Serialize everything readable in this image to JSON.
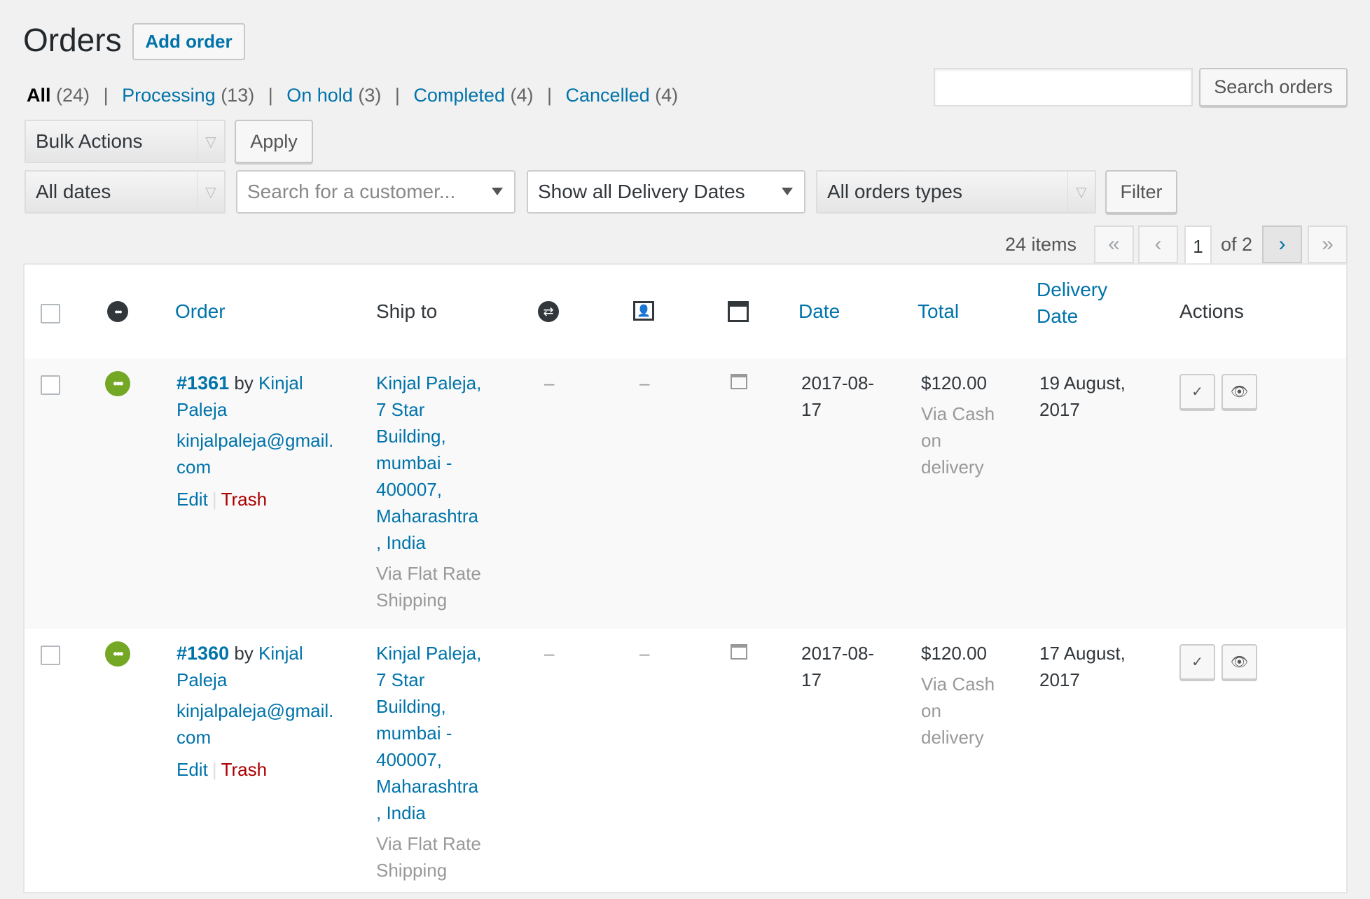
{
  "page": {
    "title": "Orders",
    "add_label": "Add order"
  },
  "filters_top": [
    {
      "label": "All",
      "count": "(24)",
      "current": true
    },
    {
      "label": "Processing",
      "count": "(13)"
    },
    {
      "label": "On hold",
      "count": "(3)"
    },
    {
      "label": "Completed",
      "count": "(4)"
    },
    {
      "label": "Cancelled",
      "count": "(4)"
    }
  ],
  "search": {
    "button_label": "Search orders",
    "value": ""
  },
  "bulk": {
    "select_label": "Bulk Actions",
    "apply_label": "Apply"
  },
  "filters": {
    "dates": "All dates",
    "customer_placeholder": "Search for a customer...",
    "delivery_dates": "Show all Delivery Dates",
    "order_types": "All orders types",
    "filter_label": "Filter"
  },
  "pagination": {
    "items": "24 items",
    "first": "«",
    "prev": "‹",
    "current_page": "1",
    "of_text": "of 2",
    "next": "›",
    "last": "»"
  },
  "columns": {
    "order": "Order",
    "ship_to": "Ship to",
    "date": "Date",
    "total": "Total",
    "delivery_date_line1": "Delivery",
    "delivery_date_line2": "Date",
    "actions": "Actions"
  },
  "icons": {
    "status_header": "ellipsis-circle-icon",
    "repeat": "repeat-icon",
    "customer": "customer-card-icon",
    "window": "window-icon",
    "complete": "checkmark-icon",
    "view": "eye-icon"
  },
  "colors": {
    "link": "#0073aa",
    "status_processing": "#73a724",
    "trash": "#a00000"
  },
  "orders": [
    {
      "number": "#1361",
      "by": "by",
      "customer_first": "Kinjal",
      "customer_last": "Paleja",
      "email_line1": "kinjalpaleja@gmail.",
      "email_line2": "com",
      "edit": "Edit",
      "trash": "Trash",
      "ship_lines": [
        "Kinjal Paleja,",
        "7 Star",
        "Building,",
        "mumbai -",
        "400007,",
        "Maharashtra",
        ", India"
      ],
      "ship_method_1": "Via Flat Rate",
      "ship_method_2": "Shipping",
      "col_repeat": "–",
      "col_customer": "–",
      "date_line1": "2017-08-",
      "date_line2": "17",
      "total": "$120.00",
      "pay_1": "Via Cash",
      "pay_2": "on",
      "pay_3": "delivery",
      "delivery_1": "19 August,",
      "delivery_2": "2017",
      "complete_glyph": "✓",
      "view_glyph": "👁"
    },
    {
      "number": "#1360",
      "by": "by",
      "customer_first": "Kinjal",
      "customer_last": "Paleja",
      "email_line1": "kinjalpaleja@gmail.",
      "email_line2": "com",
      "edit": "Edit",
      "trash": "Trash",
      "ship_lines": [
        "Kinjal Paleja,",
        "7 Star",
        "Building,",
        "mumbai -",
        "400007,",
        "Maharashtra",
        ", India"
      ],
      "ship_method_1": "Via Flat Rate",
      "ship_method_2": "Shipping",
      "col_repeat": "–",
      "col_customer": "–",
      "date_line1": "2017-08-",
      "date_line2": "17",
      "total": "$120.00",
      "pay_1": "Via Cash",
      "pay_2": "on",
      "pay_3": "delivery",
      "delivery_1": "17 August,",
      "delivery_2": "2017",
      "complete_glyph": "✓",
      "view_glyph": "👁"
    }
  ]
}
